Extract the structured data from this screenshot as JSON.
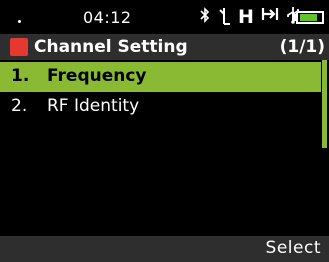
{
  "status_bar": {
    "time": "04:12",
    "icons": [
      "bluetooth-icon",
      "antenna-icon",
      "hspa-icon",
      "call-forward-icon",
      "usb-icon",
      "battery-icon"
    ],
    "h_label": "H",
    "battery_level": 0.85,
    "battery_color": "#63c22a"
  },
  "title_bar": {
    "title": "Channel Setting",
    "page": "(1/1)",
    "marker_color": "#e53930"
  },
  "menu": {
    "items": [
      {
        "number": "1.",
        "label": "Frequency",
        "selected": true
      },
      {
        "number": "2.",
        "label": "RF Identity",
        "selected": false
      }
    ],
    "highlight_color": "#8ab934"
  },
  "softkeys": {
    "right": "Select"
  }
}
